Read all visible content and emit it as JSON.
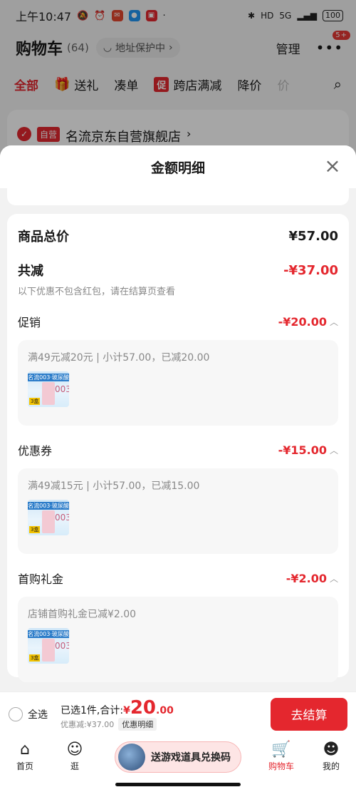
{
  "status_bar": {
    "time": "上午10:47",
    "network": "5G",
    "battery": "100"
  },
  "cart": {
    "title": "购物车",
    "count": "(64)",
    "address_chip": "地址保护中",
    "manage": "管理",
    "more_badge": "5+"
  },
  "filter_tabs": [
    {
      "label": "全部"
    },
    {
      "label": "送礼"
    },
    {
      "label": "凑单"
    },
    {
      "label": "跨店满减",
      "tag": "促"
    },
    {
      "label": "降价"
    },
    {
      "label": "价"
    }
  ],
  "store": {
    "tag": "自营",
    "name": "名流京东自营旗舰店"
  },
  "sheet": {
    "title": "金额明细",
    "total_label": "商品总价",
    "total_value": "¥57.00",
    "reduce_label": "共减",
    "reduce_value": "-¥37.00",
    "note": "以下优惠不包含红包，请在结算页查看",
    "sections": [
      {
        "label": "促销",
        "value": "-¥20.00",
        "detail": "满49元减20元 | 小计57.00，已减20.00"
      },
      {
        "label": "优惠券",
        "value": "-¥15.00",
        "detail": "满49减15元 | 小计57.00，已减15.00"
      },
      {
        "label": "首购礼金",
        "value": "-¥2.00",
        "detail": "店铺首购礼金已减¥2.00"
      }
    ],
    "thumb": {
      "title": "名流003·玻尿酸",
      "num": "003",
      "tag": "3盒"
    }
  },
  "checkout": {
    "select_all": "全选",
    "selected_text": "已选1件,合计:",
    "price_symbol": "¥",
    "price_int": "20",
    "price_dec": ".00",
    "discount_text": "优惠减:¥37.00",
    "detail_chip": "优惠明细",
    "button": "去结算"
  },
  "bottom_nav": {
    "home": "首页",
    "browse": "逛",
    "promo": "送游戏道具兑换码",
    "cart": "购物车",
    "mine": "我的"
  },
  "colors": {
    "accent": "#e4272e",
    "background": "#f2f2f2"
  }
}
